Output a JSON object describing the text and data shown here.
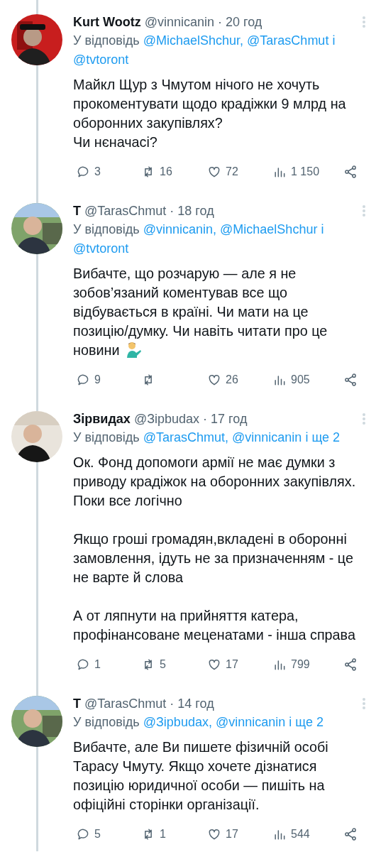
{
  "tweets": [
    {
      "name": "Kurt Wootz",
      "handle": "@vinnicanin",
      "time": "· 20 год",
      "reply": {
        "label": "У відповідь",
        "links": [
          "@MichaelShchur,",
          "@TarasChmut",
          "і",
          "@tvtoront"
        ]
      },
      "paragraphs": [
        {
          "text": "Майкл Щур з Чмутом нічого не хочуть прокоментувати щодо крадіжки 9 млрд на оборонних закупівлях?\nЧи нєначасі?",
          "emoji": false
        }
      ],
      "stats": {
        "replies": "3",
        "reposts": "16",
        "likes": "72",
        "views": "1 150"
      }
    },
    {
      "name": "T",
      "handle": "@TarasChmut",
      "time": "· 18 год",
      "reply": {
        "label": "У відповідь",
        "links": [
          "@vinnicanin,",
          "@MichaelShchur",
          "і",
          "@tvtoront"
        ]
      },
      "paragraphs": [
        {
          "text": "Вибачте, що розчарую — але я не зобов’язаний коментував все що відбувається в країні. Чи мати на це позицію/думку. Чи навіть читати про це новини",
          "emoji": true
        }
      ],
      "stats": {
        "replies": "9",
        "likes": "26",
        "views": "905"
      }
    },
    {
      "name": "Зірвидах",
      "handle": "@Зipbudax",
      "time": "· 17 год",
      "reply": {
        "label": "У відповідь",
        "links": [
          "@TarasChmut,",
          "@vinnicanin",
          "і",
          "ще",
          "2"
        ]
      },
      "paragraphs": [
        {
          "text": "Ок. Фонд допомоги армії не має думки з приводу крадіжок на оборонних закупівлях. Поки все логічно",
          "emoji": false
        },
        {
          "text": "Якщо гроші громадян,вкладені в оборонні замовлення, ідуть не за призначенням - це не варте й слова",
          "emoji": false
        },
        {
          "text": "А от ляпнути на прийняття катера, профінансоване меценатами - інша справа",
          "emoji": false
        }
      ],
      "stats": {
        "replies": "1",
        "reposts": "5",
        "likes": "17",
        "views": "799"
      }
    },
    {
      "name": "T",
      "handle": "@TarasChmut",
      "time": "· 14 год",
      "reply": {
        "label": "У відповідь",
        "links": [
          "@Зipbudax,",
          "@vinnicanin",
          "і",
          "ще",
          "2"
        ]
      },
      "paragraphs": [
        {
          "text": "Вибачте, але Ви пишете фізичній особі Тарасу Чмуту. Якщо хочете дізнатися позицію юридичної особи — пишіть на офіційні сторінки організації.",
          "emoji": false
        }
      ],
      "stats": {
        "replies": "5",
        "reposts": "1",
        "likes": "17",
        "views": "544"
      }
    }
  ]
}
